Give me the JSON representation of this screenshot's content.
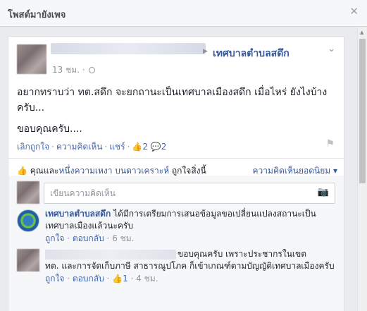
{
  "dialog": {
    "title": "โพสต์มายังเพจ",
    "close_icon": "✕"
  },
  "post": {
    "page_name": "เทศบาลตำบลสดึก",
    "time": "13 ชม.",
    "text_line1": "อยากทราบว่า ทต.สดึก จะยกถานะเป็นเทศบาลเมืองสดึก เมื่อไหร่ ยังไงบ้างครับ...",
    "text_line2": "ขอบคุณครับ....",
    "unlike": "เลิกถูกใจ",
    "comment": "ความคิดเห็น",
    "share": "แชร์",
    "like_count": "2",
    "comment_count": "2",
    "flag_icon": "flag-icon"
  },
  "likes": {
    "you_and": "คุณและ",
    "liker": "หนึ่งความเหงา บนดาวเคราะห์",
    "liked_this": "ถูกใจสิ่งนี้",
    "sort": "ความคิดเห็นยอดนิยม"
  },
  "comment_input": {
    "placeholder": "เขียนความคิดเห็น"
  },
  "comments": [
    {
      "name": "เทศบาลตำบลสดึก",
      "text": "ได้มีการเตรียมการเสนอข้อมูลขอเปลี่ยนแปลงสถานะเป็นเทศบาลเมืองแล้วนะครับ",
      "like": "ถูกใจ",
      "reply": "ตอบกลับ",
      "time": "6 ชม."
    },
    {
      "text_first": "ขอบคุณครับ เพราะประชากรในเขต",
      "text_rest": "ทต. และการจัดเก็บภาษี สาธารณูปโภค ก็เข้าเกณฑ์ตามบัญญัติเทศบาลเมืองครับ",
      "like": "ถูกใจ",
      "reply": "ตอบกลับ",
      "like_count": "1",
      "time": "4 ชม."
    }
  ]
}
